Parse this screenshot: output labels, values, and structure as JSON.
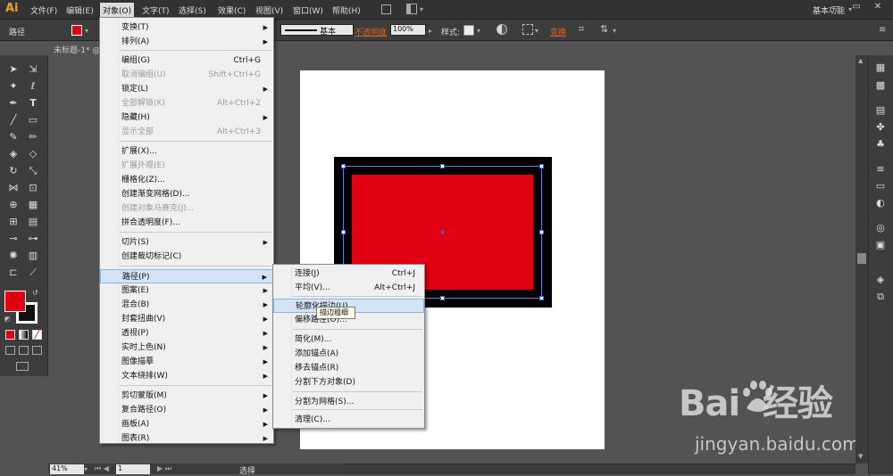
{
  "app": {
    "logo": "Ai"
  },
  "menubar": {
    "items": [
      "文件(F)",
      "编辑(E)",
      "对象(O)",
      "文字(T)",
      "选择(S)",
      "效果(C)",
      "视图(V)",
      "窗口(W)",
      "帮助(H)"
    ],
    "active": "对象(O)",
    "workspace": "基本功能",
    "window_controls": [
      "—",
      "▭",
      "✕"
    ]
  },
  "control_bar": {
    "object_type": "路径",
    "fill_color": "#e00012",
    "stroke_label": "基本",
    "opacity_label": "不透明度",
    "opacity_value": "100%",
    "style_label": "样式:",
    "transform_label": "变换"
  },
  "document_tab": {
    "title": "未标题-1* @"
  },
  "object_menu": {
    "items": [
      {
        "label": "变换(T)",
        "shortcut": "",
        "submenu": true,
        "disabled": false
      },
      {
        "label": "排列(A)",
        "shortcut": "",
        "submenu": true,
        "disabled": false
      },
      {
        "label": "编组(G)",
        "shortcut": "Ctrl+G",
        "submenu": false,
        "disabled": false
      },
      {
        "label": "取消编组(U)",
        "shortcut": "Shift+Ctrl+G",
        "submenu": false,
        "disabled": true
      },
      {
        "label": "锁定(L)",
        "shortcut": "",
        "submenu": true,
        "disabled": false
      },
      {
        "label": "全部解锁(K)",
        "shortcut": "Alt+Ctrl+2",
        "submenu": false,
        "disabled": true
      },
      {
        "label": "隐藏(H)",
        "shortcut": "",
        "submenu": true,
        "disabled": false
      },
      {
        "label": "显示全部",
        "shortcut": "Alt+Ctrl+3",
        "submenu": false,
        "disabled": true
      },
      {
        "label": "扩展(X)...",
        "shortcut": "",
        "submenu": false,
        "disabled": false
      },
      {
        "label": "扩展外观(E)",
        "shortcut": "",
        "submenu": false,
        "disabled": true
      },
      {
        "label": "栅格化(Z)...",
        "shortcut": "",
        "submenu": false,
        "disabled": false
      },
      {
        "label": "创建渐变网格(D)...",
        "shortcut": "",
        "submenu": false,
        "disabled": false
      },
      {
        "label": "创建对象马赛克(J)...",
        "shortcut": "",
        "submenu": false,
        "disabled": true
      },
      {
        "label": "拼合透明度(F)...",
        "shortcut": "",
        "submenu": false,
        "disabled": false
      },
      {
        "label": "切片(S)",
        "shortcut": "",
        "submenu": true,
        "disabled": false
      },
      {
        "label": "创建裁切标记(C)",
        "shortcut": "",
        "submenu": false,
        "disabled": false
      },
      {
        "label": "路径(P)",
        "shortcut": "",
        "submenu": true,
        "disabled": false,
        "highlighted": true
      },
      {
        "label": "图案(E)",
        "shortcut": "",
        "submenu": true,
        "disabled": false
      },
      {
        "label": "混合(B)",
        "shortcut": "",
        "submenu": true,
        "disabled": false
      },
      {
        "label": "封套扭曲(V)",
        "shortcut": "",
        "submenu": true,
        "disabled": false
      },
      {
        "label": "透视(P)",
        "shortcut": "",
        "submenu": true,
        "disabled": false
      },
      {
        "label": "实时上色(N)",
        "shortcut": "",
        "submenu": true,
        "disabled": false
      },
      {
        "label": "图像描摹",
        "shortcut": "",
        "submenu": true,
        "disabled": false
      },
      {
        "label": "文本绕排(W)",
        "shortcut": "",
        "submenu": true,
        "disabled": false
      },
      {
        "label": "剪切蒙版(M)",
        "shortcut": "",
        "submenu": true,
        "disabled": false
      },
      {
        "label": "复合路径(O)",
        "shortcut": "",
        "submenu": true,
        "disabled": false
      },
      {
        "label": "画板(A)",
        "shortcut": "",
        "submenu": true,
        "disabled": false
      },
      {
        "label": "图表(R)",
        "shortcut": "",
        "submenu": true,
        "disabled": false
      }
    ]
  },
  "path_submenu": {
    "items": [
      {
        "label": "连接(J)",
        "shortcut": "Ctrl+J"
      },
      {
        "label": "平均(V)...",
        "shortcut": "Alt+Ctrl+J"
      },
      {
        "label": "轮廓化描边(U)",
        "shortcut": "",
        "highlighted": true
      },
      {
        "label": "偏移路径(O)...",
        "shortcut": ""
      },
      {
        "label": "简化(M)...",
        "shortcut": ""
      },
      {
        "label": "添加锚点(A)",
        "shortcut": ""
      },
      {
        "label": "移去锚点(R)",
        "shortcut": ""
      },
      {
        "label": "分割下方对象(D)",
        "shortcut": ""
      },
      {
        "label": "分割为网格(S)...",
        "shortcut": ""
      },
      {
        "label": "清理(C)...",
        "shortcut": ""
      }
    ]
  },
  "tooltip": {
    "text": "描边粗细"
  },
  "status_bar": {
    "zoom": "41%",
    "page": "1",
    "tool_status": "选择"
  },
  "watermark": {
    "logo": "Bai  经验",
    "url": "jingyan.baidu.com"
  },
  "colors": {
    "fill": "#e00012",
    "stroke": "#000000",
    "selection": "#4a5fd0"
  }
}
